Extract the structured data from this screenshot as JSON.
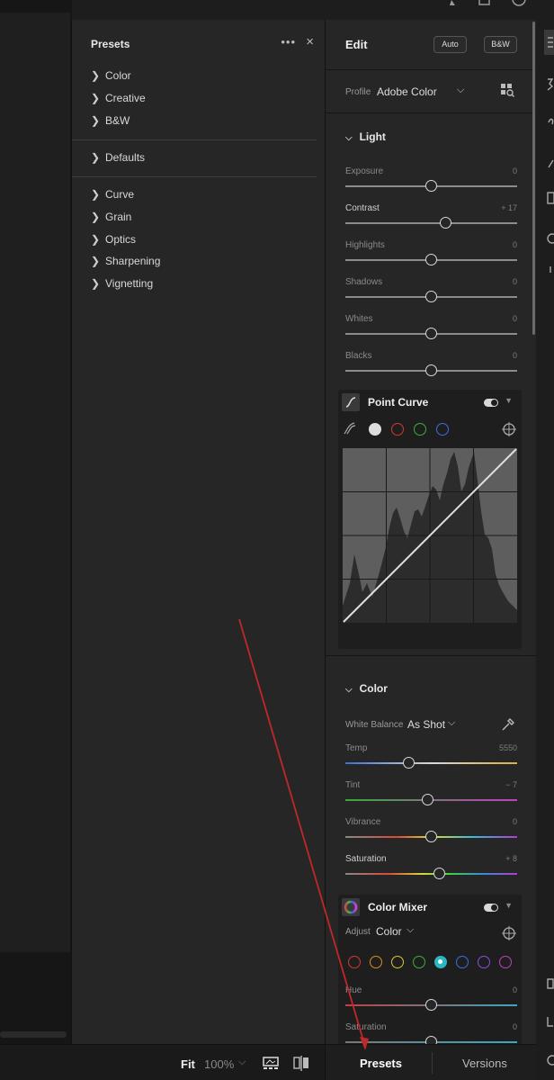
{
  "presets_panel": {
    "title": "Presets",
    "more": "•••",
    "close": "×",
    "groups": [
      {
        "items": [
          "Color",
          "Creative",
          "B&W"
        ]
      },
      {
        "items": [
          "Defaults"
        ]
      },
      {
        "items": [
          "Curve",
          "Grain",
          "Optics",
          "Sharpening",
          "Vignetting"
        ]
      }
    ]
  },
  "edit_panel": {
    "title": "Edit",
    "auto_button": "Auto",
    "bw_button": "B&W",
    "profile_label": "Profile",
    "profile_value": "Adobe Color",
    "light": {
      "title": "Light",
      "sliders": [
        {
          "label": "Exposure",
          "value": "0",
          "position": 0.5
        },
        {
          "label": "Contrast",
          "value": "+ 17",
          "position": 0.585
        },
        {
          "label": "Highlights",
          "value": "0",
          "position": 0.5
        },
        {
          "label": "Shadows",
          "value": "0",
          "position": 0.5
        },
        {
          "label": "Whites",
          "value": "0",
          "position": 0.5
        },
        {
          "label": "Blacks",
          "value": "0",
          "position": 0.5
        }
      ]
    },
    "point_curve": {
      "title": "Point Curve"
    },
    "color": {
      "title": "Color",
      "white_balance_label": "White Balance",
      "white_balance_value": "As Shot",
      "sliders": [
        {
          "label": "Temp",
          "value": "5550",
          "position": 0.37
        },
        {
          "label": "Tint",
          "value": "− 7",
          "position": 0.48
        },
        {
          "label": "Vibrance",
          "value": "0",
          "position": 0.5
        },
        {
          "label": "Saturation",
          "value": "+ 8",
          "position": 0.545
        }
      ]
    },
    "color_mixer": {
      "title": "Color Mixer",
      "adjust_label": "Adjust",
      "adjust_value": "Color",
      "swatches": [
        "#d43a2f",
        "#e08a20",
        "#d8c830",
        "#3cae3c",
        "#2ab7c4",
        "#3b6fe0",
        "#8a4fe0",
        "#c43fc4"
      ],
      "selected_swatch": 4,
      "sliders": [
        {
          "label": "Hue",
          "value": "0",
          "position": 0.5
        },
        {
          "label": "Saturation",
          "value": "0",
          "position": 0.5
        }
      ]
    }
  },
  "bottom_bar": {
    "fit_label": "Fit",
    "zoom_value": "100%",
    "presets_tab": "Presets",
    "versions_tab": "Versions"
  }
}
